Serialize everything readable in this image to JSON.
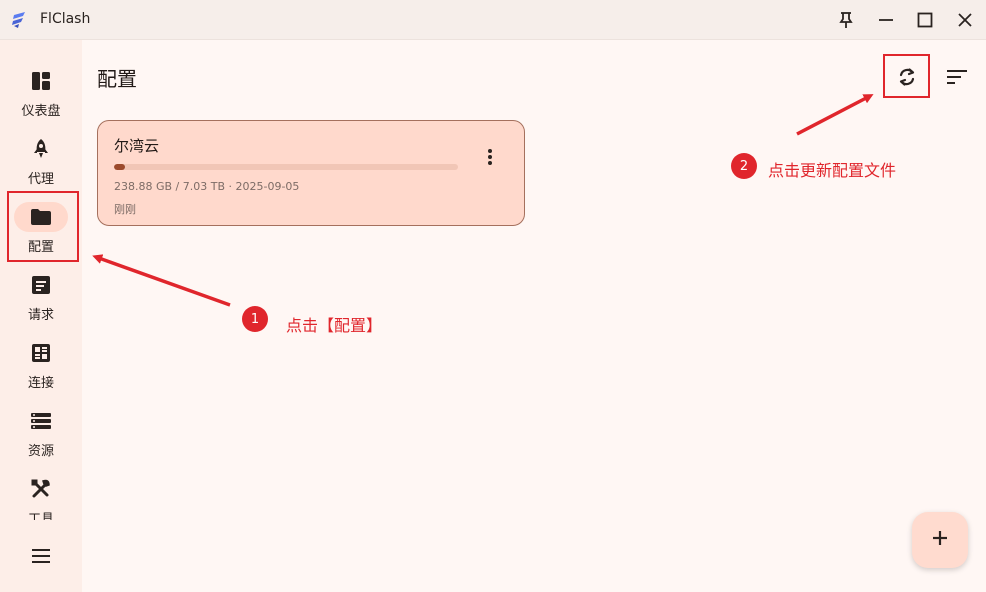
{
  "app": {
    "title": "FlClash",
    "icons": [
      "flclash-logo-icon"
    ]
  },
  "window_controls": {
    "icons": [
      "pin-icon",
      "minimize-icon",
      "maximize-icon",
      "close-icon"
    ]
  },
  "sidebar": {
    "items": [
      {
        "label": "仪表盘",
        "icon": "dashboard-icon",
        "active": false
      },
      {
        "label": "代理",
        "icon": "rocket-icon",
        "active": false
      },
      {
        "label": "配置",
        "icon": "folder-icon",
        "active": true
      },
      {
        "label": "请求",
        "icon": "request-icon",
        "active": false
      },
      {
        "label": "连接",
        "icon": "connections-icon",
        "active": false
      },
      {
        "label": "资源",
        "icon": "resources-icon",
        "active": false
      },
      {
        "label": "工具",
        "icon": "tools-icon",
        "active": false
      }
    ],
    "menu_icon": "hamburger-menu-icon"
  },
  "main": {
    "title": "配置",
    "toolbar_icons": [
      "refresh-icon",
      "sort-icon"
    ],
    "profile": {
      "name": "尔湾云",
      "usage": "238.88 GB / 7.03 TB · 2025-09-05",
      "updated": "刚刚",
      "usage_fraction": 0.033,
      "menu_icon": "more-vertical-icon"
    },
    "fab_icon": "plus-icon"
  },
  "annotations": {
    "step1_number": "1",
    "step1_text": "点击【配置】",
    "step2_number": "2",
    "step2_text": "点击更新配置文件",
    "color": "#e0262c"
  },
  "colors": {
    "background": "#fff7f4",
    "sidebar": "#fdeee8",
    "card": "#ffd9cc",
    "accent": "#9c4a2c",
    "annotation": "#e0262c"
  }
}
